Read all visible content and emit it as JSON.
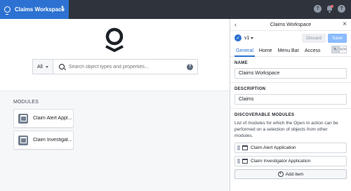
{
  "topbar": {
    "workspace_title": "Claims Workspace",
    "help_glyph": "?",
    "account_glyph": "?"
  },
  "main": {
    "search": {
      "scope_label": "All",
      "placeholder": "Search object types and properties..."
    },
    "modules_heading": "MODULES",
    "modules": [
      {
        "label": "Claim Alert Appl..."
      },
      {
        "label": "Claim Investigat..."
      }
    ]
  },
  "panel": {
    "title": "Claims Workspace",
    "version": "v1",
    "discard_label": "Discard",
    "save_label": "Save",
    "tabs": [
      {
        "label": "General"
      },
      {
        "label": "Home"
      },
      {
        "label": "Menu Bar"
      },
      {
        "label": "Access"
      }
    ],
    "name_label": "NAME",
    "name_value": "Claims Workspace",
    "description_label": "DESCRIPTION",
    "description_value": "Claims",
    "discoverable_label": "DISCOVERABLE MODULES",
    "discoverable_desc": "List of modules for which the Open In action can be performed on a selection of objects from other modules.",
    "discoverable_items": [
      {
        "label": "Claim Alert Application"
      },
      {
        "label": "Claim Investigator Application"
      }
    ],
    "add_item_label": "Add item"
  },
  "colors": {
    "accent": "#2d72d2",
    "topbar": "#2f343c",
    "save_disabled": "#8abbff"
  }
}
